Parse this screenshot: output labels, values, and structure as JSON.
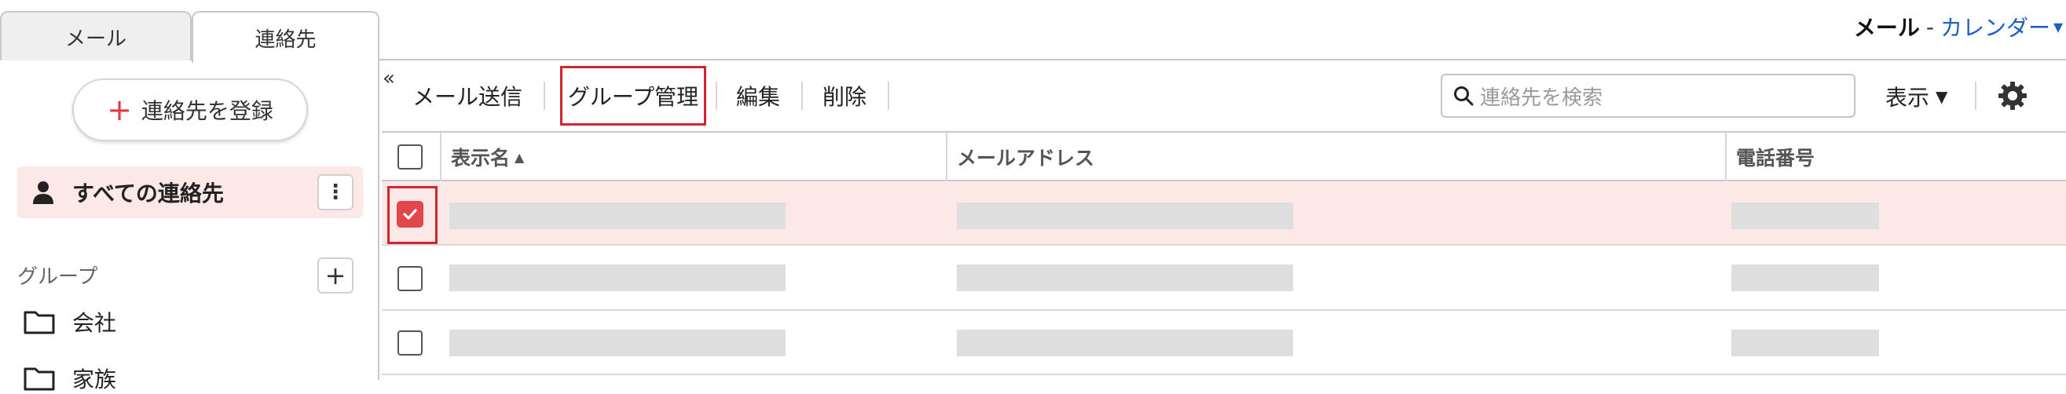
{
  "tabs": [
    {
      "label": "メール"
    },
    {
      "label": "連絡先"
    }
  ],
  "app_links": {
    "current": "メール",
    "separator": "-",
    "link": "カレンダー"
  },
  "sidebar": {
    "register_label": "連絡先を登録",
    "all_contacts_label": "すべての連絡先",
    "kebab": "⋮",
    "groups_header": "グループ",
    "groups": [
      {
        "label": "会社"
      },
      {
        "label": "家族"
      }
    ]
  },
  "toolbar": {
    "collapse": "«",
    "send_mail": "メール送信",
    "group_manage": "グループ管理",
    "edit": "編集",
    "delete": "削除",
    "search_placeholder": "連絡先を検索",
    "display": "表示"
  },
  "table": {
    "columns": [
      {
        "label": "表示名",
        "sort": "▲"
      },
      {
        "label": "メールアドレス"
      },
      {
        "label": "電話番号"
      }
    ],
    "rows": [
      {
        "selected": true
      },
      {
        "selected": false
      },
      {
        "selected": false
      }
    ]
  },
  "colors": {
    "accent": "#e0393e",
    "highlight": "#d0252c",
    "selected_row": "#fde8e8",
    "link": "#1a5fc1"
  }
}
